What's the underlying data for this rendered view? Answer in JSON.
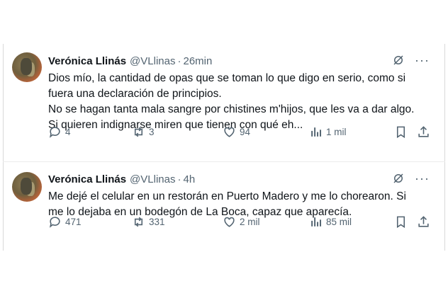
{
  "tweets": [
    {
      "author_name": "Verónica Llinás",
      "handle": "@VLlinas",
      "separator": "·",
      "time": "26min",
      "more_label": "···",
      "text": "Dios mío, la cantidad de opas que se toman lo que digo en serio, como si\nfuera una declaración de principios.\nNo se hagan tanta mala sangre por chistines m'hijos, que les va a dar algo.\nSi quieren indignarse miren que tienen con qué eh...",
      "replies": "4",
      "reposts": "3",
      "likes": "94",
      "views": "1 mil"
    },
    {
      "author_name": "Verónica Llinás",
      "handle": "@VLlinas",
      "separator": "·",
      "time": "4h",
      "more_label": "···",
      "text": "Me dejé el celular en un restorán en Puerto Madero y me lo chorearon. Si\nme lo dejaba en un bodegón de La Boca, capaz que aparecía.",
      "replies": "471",
      "reposts": "331",
      "likes": "2 mil",
      "views": "85 mil"
    }
  ],
  "icons": {
    "grok": "grok-icon",
    "more": "more-icon",
    "reply": "reply-icon",
    "repost": "repost-icon",
    "like": "heart-icon",
    "views": "views-icon",
    "bookmark": "bookmark-icon",
    "share": "share-icon"
  },
  "colors": {
    "text": "#0f1419",
    "muted": "#536471",
    "border": "#d9d9d9"
  }
}
